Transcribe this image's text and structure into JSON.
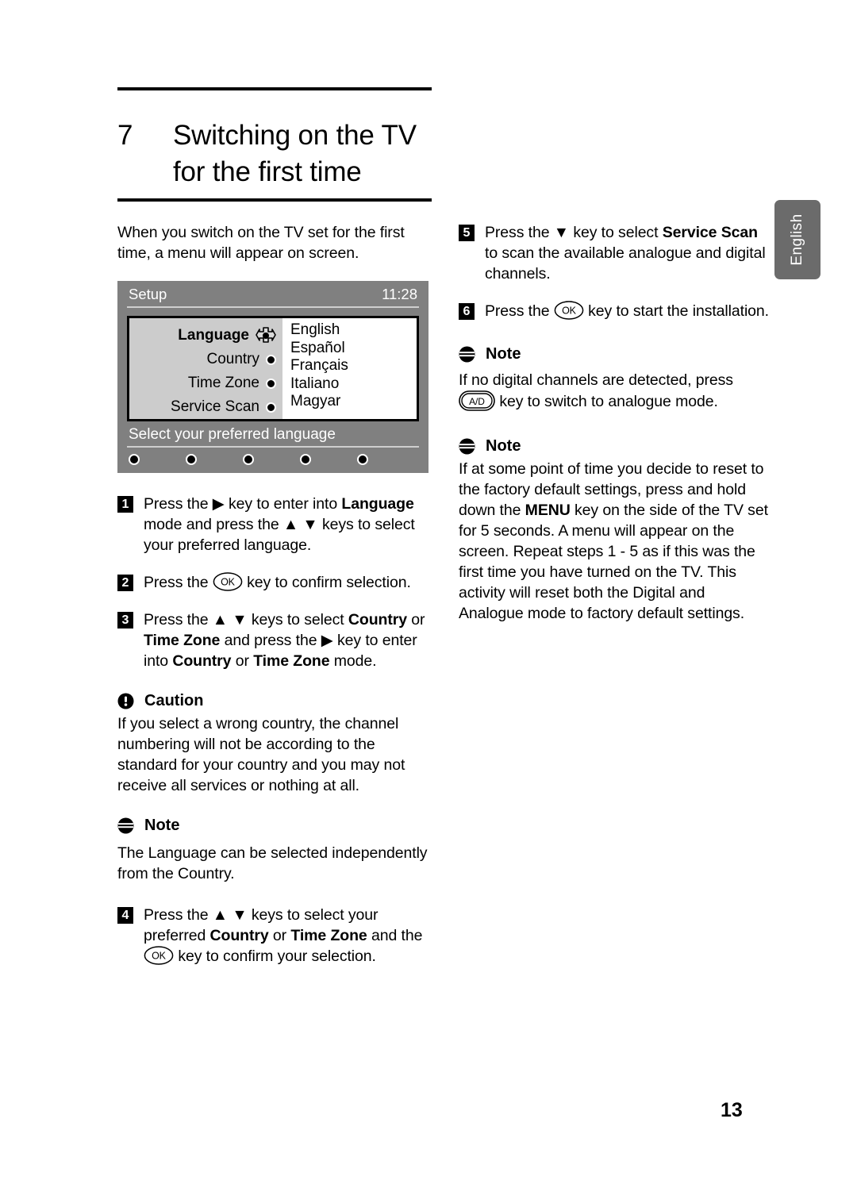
{
  "side_tab": {
    "label": "English"
  },
  "header": {
    "chapter_number": "7",
    "chapter_title_line1": "Switching on the TV",
    "chapter_title_line2": "for the first time"
  },
  "intro": "When you switch on the TV set for the first time, a menu will appear on screen.",
  "tv_menu": {
    "title": "Setup",
    "clock": "11:28",
    "items": [
      {
        "label": "Language",
        "active": true
      },
      {
        "label": "Country",
        "active": false
      },
      {
        "label": "Time Zone",
        "active": false
      },
      {
        "label": "Service Scan",
        "active": false
      }
    ],
    "languages": [
      "English",
      "Español",
      "Français",
      "Italiano",
      "Magyar"
    ],
    "hint": "Select your preferred language",
    "colors": {
      "header_gray": "#808080",
      "panel_gray": "#cccccc",
      "list_white": "#ffffff"
    }
  },
  "steps_left": [
    {
      "number": "1",
      "parts": [
        {
          "t": "text",
          "v": "Press the "
        },
        {
          "t": "icon",
          "v": "arrow-right-icon"
        },
        {
          "t": "text",
          "v": " key to enter into "
        },
        {
          "t": "bold",
          "v": "Language"
        },
        {
          "t": "text",
          "v": " mode and press the "
        },
        {
          "t": "icon",
          "v": "arrow-up-icon"
        },
        {
          "t": "icon",
          "v": "arrow-down-icon"
        },
        {
          "t": "text",
          "v": " keys to select your preferred language."
        }
      ]
    },
    {
      "number": "2",
      "parts": [
        {
          "t": "text",
          "v": "Press the "
        },
        {
          "t": "icon",
          "v": "ok-key-icon"
        },
        {
          "t": "text",
          "v": " key to confirm selection."
        }
      ]
    },
    {
      "number": "3",
      "parts": [
        {
          "t": "text",
          "v": "Press the "
        },
        {
          "t": "icon",
          "v": "arrow-up-icon"
        },
        {
          "t": "icon",
          "v": "arrow-down-icon"
        },
        {
          "t": "text",
          "v": " keys to select "
        },
        {
          "t": "bold",
          "v": "Country"
        },
        {
          "t": "text",
          "v": " or "
        },
        {
          "t": "bold",
          "v": "Time Zone"
        },
        {
          "t": "text",
          "v": " and press the "
        },
        {
          "t": "icon",
          "v": "arrow-right-icon"
        },
        {
          "t": "text",
          "v": " key to enter into "
        },
        {
          "t": "bold",
          "v": "Country"
        },
        {
          "t": "text",
          "v": " or "
        },
        {
          "t": "bold",
          "v": "Time Zone"
        },
        {
          "t": "text",
          "v": " mode."
        }
      ]
    },
    {
      "number": "4",
      "parts": [
        {
          "t": "text",
          "v": "Press the "
        },
        {
          "t": "icon",
          "v": "arrow-up-icon"
        },
        {
          "t": "icon",
          "v": "arrow-down-icon"
        },
        {
          "t": "text",
          "v": " keys to select your preferred "
        },
        {
          "t": "bold",
          "v": "Country"
        },
        {
          "t": "text",
          "v": " or "
        },
        {
          "t": "bold",
          "v": "Time Zone"
        },
        {
          "t": "text",
          "v": " and the "
        },
        {
          "t": "icon",
          "v": "ok-key-icon"
        },
        {
          "t": "text",
          "v": " key to confirm your selection."
        }
      ]
    }
  ],
  "callout_caution": {
    "icon": "caution-icon",
    "title": "Caution",
    "body": "If you select a wrong country, the channel numbering will not be according to the standard for your country and you may not receive all services or nothing at all."
  },
  "callout_note_left": {
    "icon": "note-icon",
    "title": "Note",
    "body": "The Language can be selected independently from the Country."
  },
  "steps_right": [
    {
      "number": "5",
      "parts": [
        {
          "t": "text",
          "v": "Press the "
        },
        {
          "t": "icon",
          "v": "arrow-down-icon"
        },
        {
          "t": "text",
          "v": " key to select "
        },
        {
          "t": "bold",
          "v": "Service Scan"
        },
        {
          "t": "text",
          "v": " to scan the available analogue and digital channels."
        }
      ]
    },
    {
      "number": "6",
      "parts": [
        {
          "t": "text",
          "v": "Press the "
        },
        {
          "t": "icon",
          "v": "ok-key-icon"
        },
        {
          "t": "text",
          "v": " key to start the installation."
        }
      ]
    }
  ],
  "callout_note_right_1": {
    "icon": "note-icon",
    "title": "Note",
    "body_part1": "If no digital channels are detected, press ",
    "key": "A/D",
    "body_part2": " key to switch to analogue mode."
  },
  "callout_note_right_2": {
    "icon": "note-icon",
    "title": "Note",
    "body_part1": "If at some point of time you decide to reset to the factory default settings, press and hold down the ",
    "bold_key": "MENU",
    "body_part2": " key on the side of the TV set for 5 seconds. A menu will appear on the screen. Repeat steps 1 - 5 as if this was the first time you have turned on the TV. This activity will reset both the Digital and Analogue mode to factory default settings."
  },
  "page_number": "13"
}
